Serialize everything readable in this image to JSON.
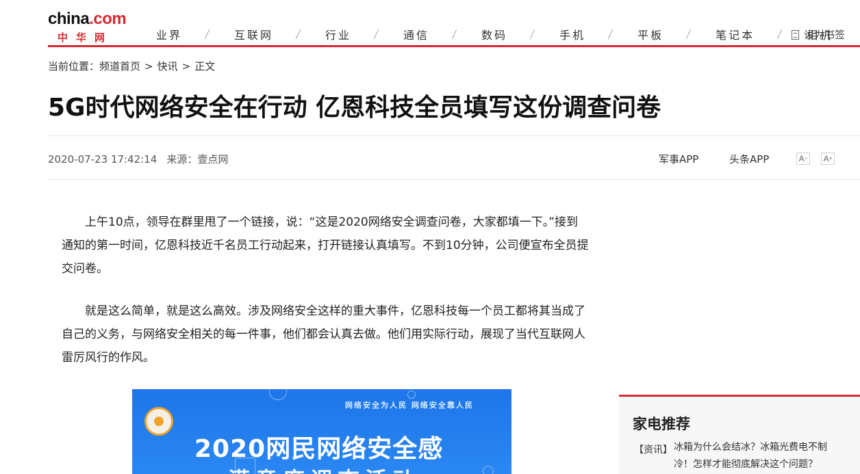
{
  "logo": {
    "main": "china",
    "dot": ".",
    "com": "com",
    "sub": "中华网"
  },
  "nav": [
    {
      "label": "业界"
    },
    {
      "label": "互联网"
    },
    {
      "label": "行业"
    },
    {
      "label": "通信"
    },
    {
      "label": "数码"
    },
    {
      "label": "手机"
    },
    {
      "label": "平板"
    },
    {
      "label": "笔记本"
    },
    {
      "label": "相机"
    }
  ],
  "bookmark": {
    "label": "设为书签",
    "icon": "bookmark-icon"
  },
  "breadcrumb": {
    "prefix": "当前位置：",
    "items": [
      "频道首页",
      "快讯",
      "正文"
    ],
    "sep": ">"
  },
  "article": {
    "title": "5G时代网络安全在行动 亿恩科技全员填写这份调查问卷",
    "datetime": "2020-07-23 17:42:14",
    "source": "来源：壹点网",
    "paragraphs": [
      "上午10点，领导在群里甩了一个链接，说：“这是2020网络安全调查问卷，大家都填一下。”接到通知的第一时间，亿恩科技近千名员工行动起来，打开链接认真填写。不到10分钟，公司便宣布全员提交问卷。",
      "就是这么简单，就是这么高效。涉及网络安全这样的重大事件，亿恩科技每一个员工都将其当成了自己的义务，与网络安全相关的每一件事，他们都会认真去做。他们用实际行动，展现了当代互联网人雷厉风行的作风。"
    ]
  },
  "apps": {
    "military": "军事APP",
    "headline": "头条APP"
  },
  "font_controls": {
    "decrease": "A",
    "increase": "A",
    "decrease_mark": "−",
    "increase_mark": "+"
  },
  "banner": {
    "slogan": "网络安全为人民  网络安全靠人民",
    "main": "2020网民网络安全感",
    "sub": "满意度调查活动"
  },
  "sidebar": {
    "title": "家电推荐",
    "items": [
      {
        "tag": "【资讯】",
        "text": "冰箱为什么会结冰？冰箱光费电不制冷！怎样才能彻底解决这个问题？"
      }
    ]
  },
  "colors": {
    "brand_red": "#d8282f",
    "banner_blue": "#1e76ea"
  }
}
